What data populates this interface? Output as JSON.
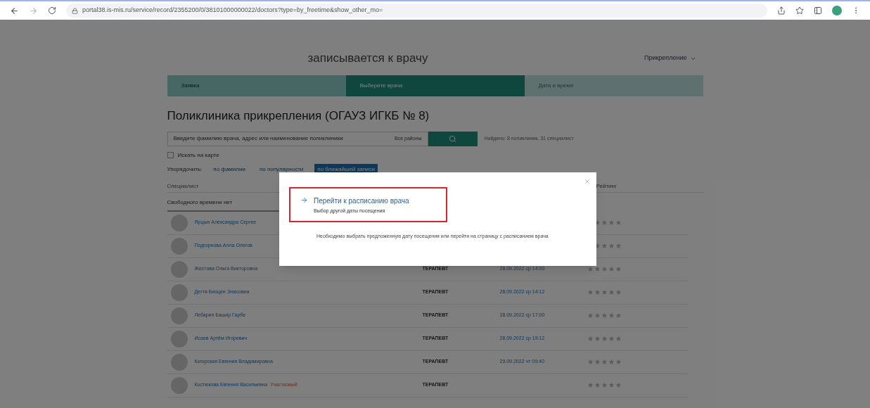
{
  "browser": {
    "url": "portal38.is-mis.ru/service/record/2355200/0/38101000000022/doctors?type=by_freetime&show_other_mo="
  },
  "header": {
    "title": "записывается к врачу",
    "account": "Прикрепление"
  },
  "steps": [
    {
      "label": "Заявка",
      "selected": false
    },
    {
      "label": "Выберите врача",
      "selected": true
    },
    {
      "label": "Дата и время",
      "selected": false
    }
  ],
  "heading": "Поликлиника прикрепления (ОГАУЗ ИГКБ № 8)",
  "search": {
    "placeholder": "Введите фамилию врача, адрес или наименование поликлиники",
    "district": "Все районы",
    "found": "Найдено: 8 поликлиник, 31 специалист"
  },
  "map_checkbox": {
    "label": "Искать на карте",
    "checked": false
  },
  "sort": {
    "label": "Упорядочить:",
    "options": [
      {
        "label": "по фамилии",
        "selected": false
      },
      {
        "label": "по популярности",
        "selected": false
      },
      {
        "label": "по ближайшей записи",
        "selected": true
      }
    ]
  },
  "columns": [
    "Специалист",
    "Рейтинг"
  ],
  "group_header": "Свободного времени нет",
  "doctors": [
    {
      "name": "Ярцын Александра Сергее",
      "stars": 0
    },
    {
      "name": "Подгорнова Алла Олегов",
      "stars": 0
    },
    {
      "name": "Жестова Ольга Викторовна",
      "specialty": "ТЕРАПЕВТ",
      "slot": "28.09.2022 ср 14:00",
      "stars": 0
    },
    {
      "name": "Дегтя Биоцен Элисовна",
      "specialty": "ТЕРАПЕВТ",
      "slot": "28.09.2022 ср 14:12",
      "stars": 0
    },
    {
      "name": "Лебарин Башир Гарбе",
      "specialty": "ТЕРАПЕВТ",
      "slot": "28.09.2022 ср 17:00",
      "stars": 0
    },
    {
      "name": "Исаев Артём Игоревич",
      "specialty": "ТЕРАПЕВТ",
      "slot": "28.09.2022 ср 19:12",
      "stars": 0
    },
    {
      "name": "Когорская Евгения Владимировна",
      "specialty": "ТЕРАПЕВТ",
      "slot": "29.09.2022 чт 09:40",
      "stars": 0
    },
    {
      "name": "Костюкова Евгения Васильевна",
      "tag": "Участковый",
      "specialty": "ТЕРАПЕВТ",
      "stars": 0
    }
  ],
  "modal": {
    "link": "Перейти к расписанию врача",
    "subtitle": "Выбор другой даты посещения",
    "message": "Необходимо выбрать предложенную дату посещения или перейти на страницу с расписанием врача"
  }
}
